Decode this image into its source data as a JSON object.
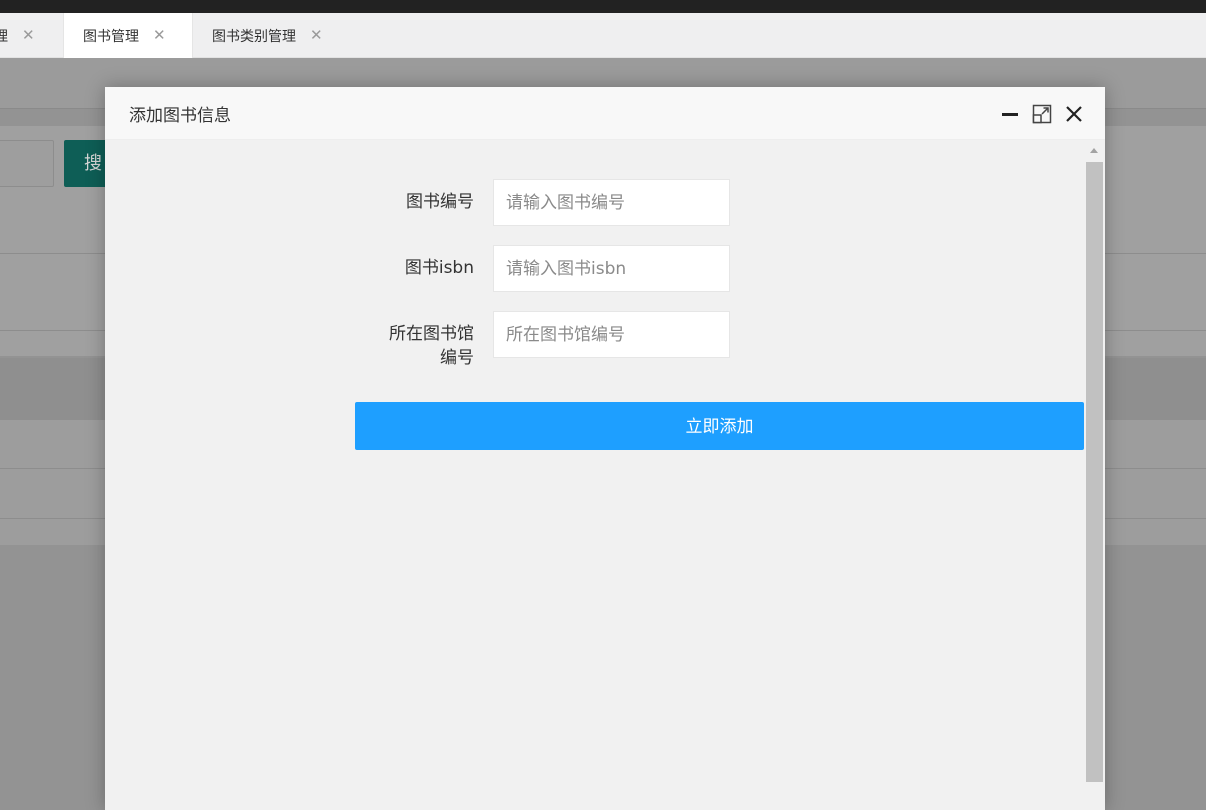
{
  "tabs": [
    {
      "label": "理",
      "active": false
    },
    {
      "label": "图书管理",
      "active": true
    },
    {
      "label": "图书类别管理",
      "active": false
    }
  ],
  "background": {
    "search_button_label": "搜"
  },
  "modal": {
    "title": "添加图书信息",
    "fields": [
      {
        "label": "图书编号",
        "placeholder": "请输入图书编号",
        "value": ""
      },
      {
        "label": "图书isbn",
        "placeholder": "请输入图书isbn",
        "value": ""
      },
      {
        "label_line1": "所在图书馆",
        "label_line2": "编号",
        "placeholder": "所在图书馆编号",
        "value": ""
      }
    ],
    "submit_label": "立即添加"
  },
  "icons": {
    "tab_close": "close-icon",
    "minimize": "minimize-icon",
    "maximize": "maximize-icon",
    "close": "close-icon"
  },
  "colors": {
    "primary": "#1e9fff",
    "search_button": "#0e5e56",
    "overlay": "#939393"
  }
}
